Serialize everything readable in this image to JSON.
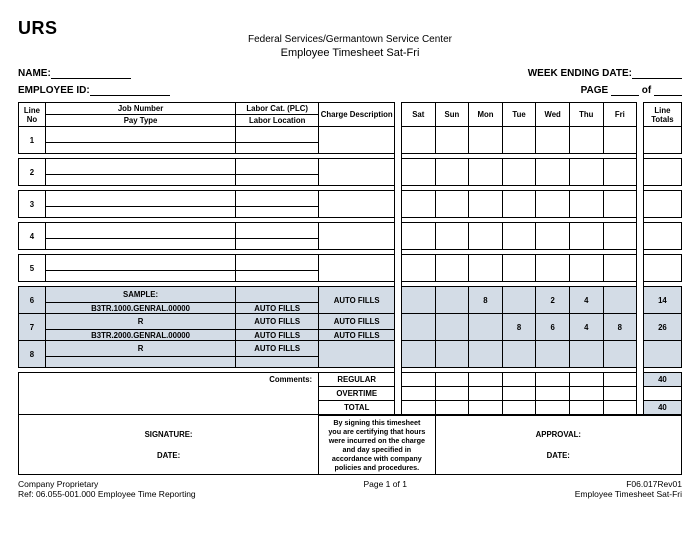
{
  "logo": "URS",
  "header": {
    "line1": "Federal Services/Germantown Service Center",
    "line2": "Employee Timesheet Sat-Fri"
  },
  "meta": {
    "name_label": "NAME:",
    "wed_label": "WEEK ENDING DATE:",
    "emp_label": "EMPLOYEE ID:",
    "page_label": "PAGE",
    "of_label": "of"
  },
  "cols": {
    "line_no": "Line No",
    "job_number": "Job Number",
    "pay_type": "Pay Type",
    "labor_cat": "Labor Cat. (PLC)",
    "labor_loc": "Labor Location",
    "charge_desc": "Charge Description",
    "days": [
      "Sat",
      "Sun",
      "Mon",
      "Tue",
      "Wed",
      "Thu",
      "Fri"
    ],
    "line_totals": "Line Totals"
  },
  "rows": {
    "nums": [
      "1",
      "2",
      "3",
      "4",
      "5",
      "6",
      "7",
      "8"
    ],
    "sample": "SAMPLE:",
    "b1": "B3TR.1000.GENRAL.00000",
    "b2": "B3TR.2000.GENRAL.00000",
    "r": "R",
    "auto_fills": "AUTO FILLS",
    "r6_vals": {
      "mon": "8",
      "wed": "2",
      "thu": "4",
      "total": "14"
    },
    "r7_vals": {
      "tue": "8",
      "wed": "6",
      "thu": "4",
      "fri": "8",
      "total": "26"
    }
  },
  "summary": {
    "comments": "Comments:",
    "regular": "REGULAR",
    "overtime": "OVERTIME",
    "total": "TOTAL",
    "reg_val": "40",
    "tot_val": "40"
  },
  "sig": {
    "signature": "SIGNATURE:",
    "date": "DATE:",
    "approval": "APPROVAL:",
    "cert": "By signing this timesheet you are certifying that hours were incurred on the charge and day specified in accordance with company policies and procedures."
  },
  "footer": {
    "l1": "Company Proprietary",
    "l2": "Ref: 06.055-001.000 Employee Time Reporting",
    "c": "Page 1 of 1",
    "r1": "F06.017Rev01",
    "r2": "Employee Timesheet Sat-Fri"
  }
}
